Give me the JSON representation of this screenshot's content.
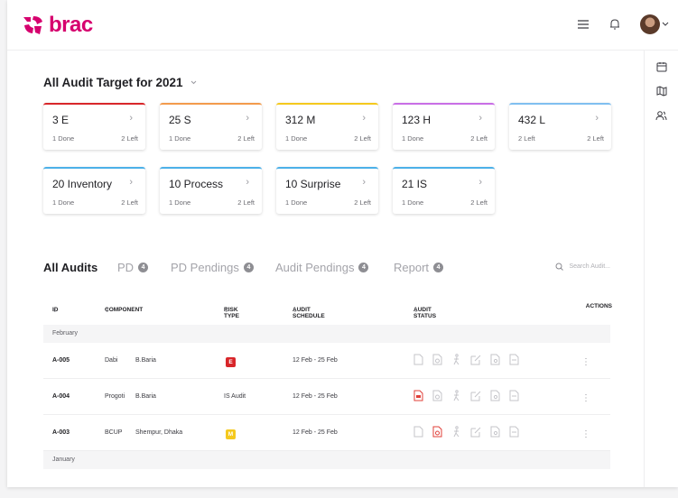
{
  "app": {
    "logo_text": "brac"
  },
  "header": {
    "menu_icon": "menu-icon",
    "bell_icon": "bell-icon",
    "avatar_icon": "avatar",
    "dropdown_icon": "chevron-down-icon"
  },
  "rail": {
    "items": [
      "calendar-icon",
      "map-icon",
      "users-icon"
    ]
  },
  "targets": {
    "title": "All Audit Target for 2021",
    "cards": [
      {
        "title": "3 E",
        "done": "1 Done",
        "left": "2 Left",
        "color": "#d8262a"
      },
      {
        "title": "25 S",
        "done": "1 Done",
        "left": "2 Left",
        "color": "#f39b4c"
      },
      {
        "title": "312 M",
        "done": "1 Done",
        "left": "2 Left",
        "color": "#f5c91e"
      },
      {
        "title": "123 H",
        "done": "1 Done",
        "left": "2 Left",
        "color": "#c96ee6"
      },
      {
        "title": "432 L",
        "done": "2 Left",
        "left": "2 Left",
        "color": "#80bff0"
      },
      {
        "title": "20 Inventory",
        "done": "1 Done",
        "left": "2 Left",
        "color": "#4cb0e8"
      },
      {
        "title": "10 Process",
        "done": "1 Done",
        "left": "2 Left",
        "color": "#4cb0e8"
      },
      {
        "title": "10 Surprise",
        "done": "1 Done",
        "left": "2 Left",
        "color": "#4cb0e8"
      },
      {
        "title": "21 IS",
        "done": "1 Done",
        "left": "2 Left",
        "color": "#4cb0e8"
      }
    ]
  },
  "tabs": [
    {
      "label": "All Audits",
      "badge": ""
    },
    {
      "label": "PD",
      "badge": "4"
    },
    {
      "label": "PD Pendings",
      "badge": "4"
    },
    {
      "label": "Audit Pendings",
      "badge": "4"
    },
    {
      "label": "Report",
      "badge": "4"
    }
  ],
  "search": {
    "placeholder": "Search Audit..."
  },
  "table": {
    "headers": {
      "id": "ID",
      "component": "COMPONENT",
      "risk_type": "RISK TYPE",
      "schedule": "AUDIT SCHEDULE",
      "status": "AUDIT STATUS",
      "actions": "ACTIONS"
    },
    "months": [
      "February",
      "January"
    ],
    "rows": [
      {
        "id": "A-005",
        "component": "Dabi",
        "location": "B.Baria",
        "risk": "E",
        "risk_color": "#d8262a",
        "schedule": "12 Feb - 25 Feb"
      },
      {
        "id": "A-004",
        "component": "Progoti",
        "location": "B.Baria",
        "risk": "IS Audit",
        "risk_color": "",
        "schedule": "12 Feb - 25 Feb"
      },
      {
        "id": "A-003",
        "component": "BCUP",
        "location": "Shempur, Dhaka",
        "risk": "M",
        "risk_color": "#f5c91e",
        "schedule": "12 Feb - 25 Feb"
      }
    ]
  },
  "colors": {
    "brand": "#d6006e",
    "status_alert": "#e0403a",
    "status_idle": "#c4c4c9"
  }
}
